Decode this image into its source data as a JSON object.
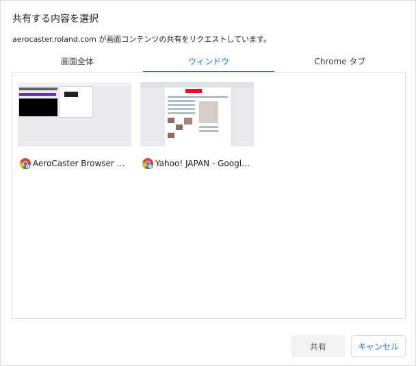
{
  "dialog": {
    "title": "共有する内容を選択",
    "subtitle": "aerocaster.roland.com が画面コンテンツの共有をリクエストしています。"
  },
  "tabs": [
    {
      "label": "画面全体",
      "active": false
    },
    {
      "label": "ウィンドウ",
      "active": true
    },
    {
      "label": "Chrome タブ",
      "active": false
    }
  ],
  "windows": [
    {
      "label": "AeroCaster Browser Sen...",
      "icon": "chrome-icon"
    },
    {
      "label": "Yahoo! JAPAN - Google...",
      "icon": "chrome-icon"
    }
  ],
  "buttons": {
    "share_label": "共有",
    "cancel_label": "キャンセル"
  },
  "colors": {
    "accent": "#1a73e8",
    "border": "#dadce0",
    "disabled_bg": "#f1f3f4"
  }
}
